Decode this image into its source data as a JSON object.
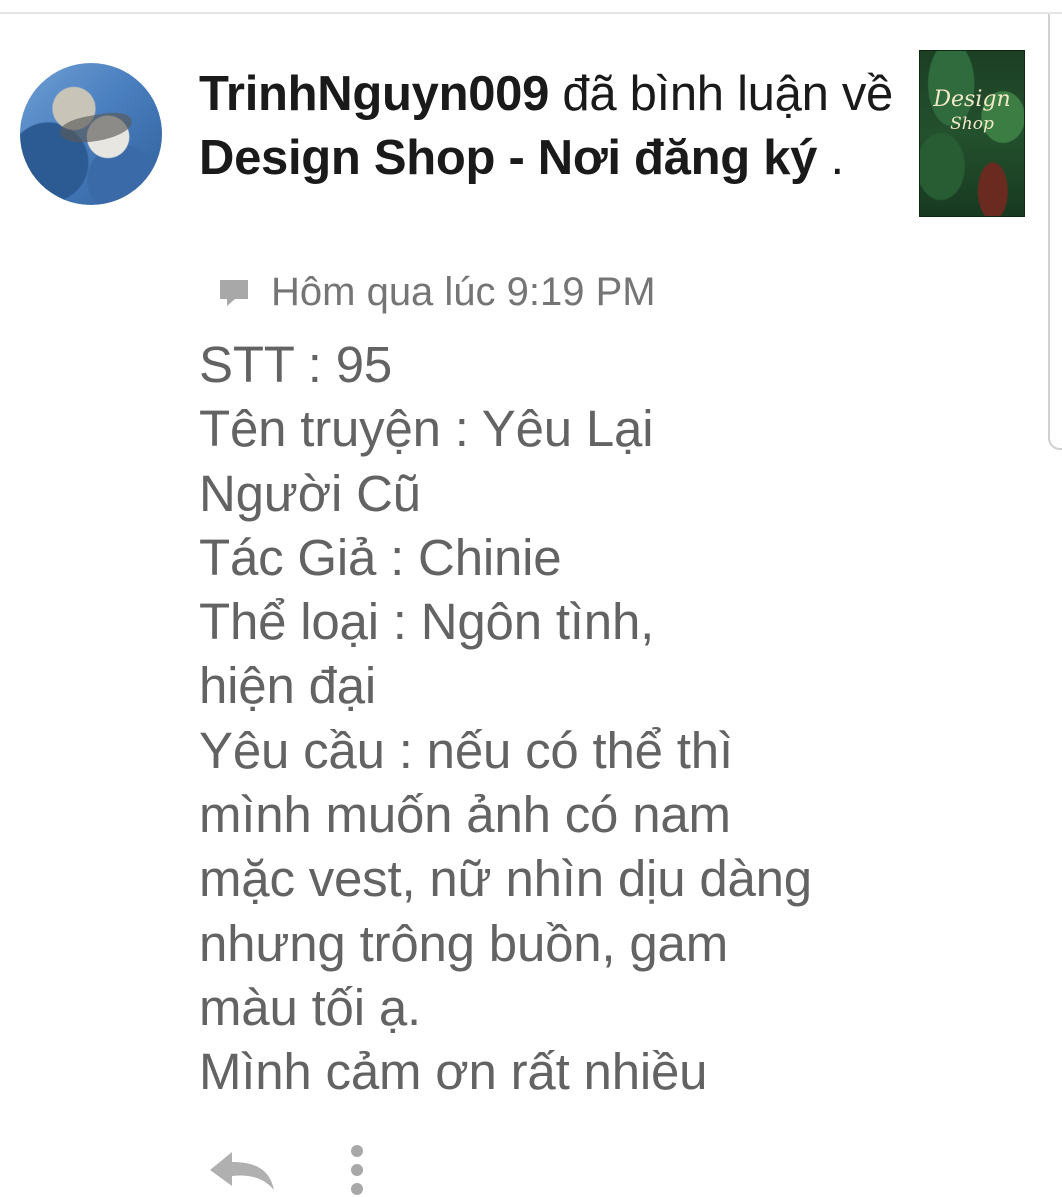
{
  "notification": {
    "author": "TrinhNguyn009",
    "action": " đã bình luận về ",
    "target": "Design Shop - Nơi đăng ký",
    "suffix": " .",
    "timestamp": "Hôm qua lúc 9:19 PM",
    "thumbnail_text": [
      "Design",
      "Shop"
    ],
    "icons": {
      "avatar": "profile-avatar",
      "meta": "comment-icon",
      "reply": "reply-icon",
      "more": "more-vertical-icon"
    }
  },
  "comment": {
    "lines": [
      "STT : 95",
      "Tên truyện : Yêu Lại",
      "Người Cũ",
      "Tác Giả : Chinie",
      "Thể loại : Ngôn tình,",
      "hiện đại",
      "Yêu cầu : nếu có thể thì",
      "mình muốn ảnh có nam",
      "mặc vest, nữ nhìn dịu dàng",
      "nhưng trông buồn, gam",
      "màu tối ạ.",
      "Mình cảm ơn rất nhiều"
    ]
  },
  "colors": {
    "primary_text": "#1a1a1a",
    "secondary_text": "#636363",
    "meta_text": "#757575",
    "icon_gray": "#a8a8a8"
  }
}
